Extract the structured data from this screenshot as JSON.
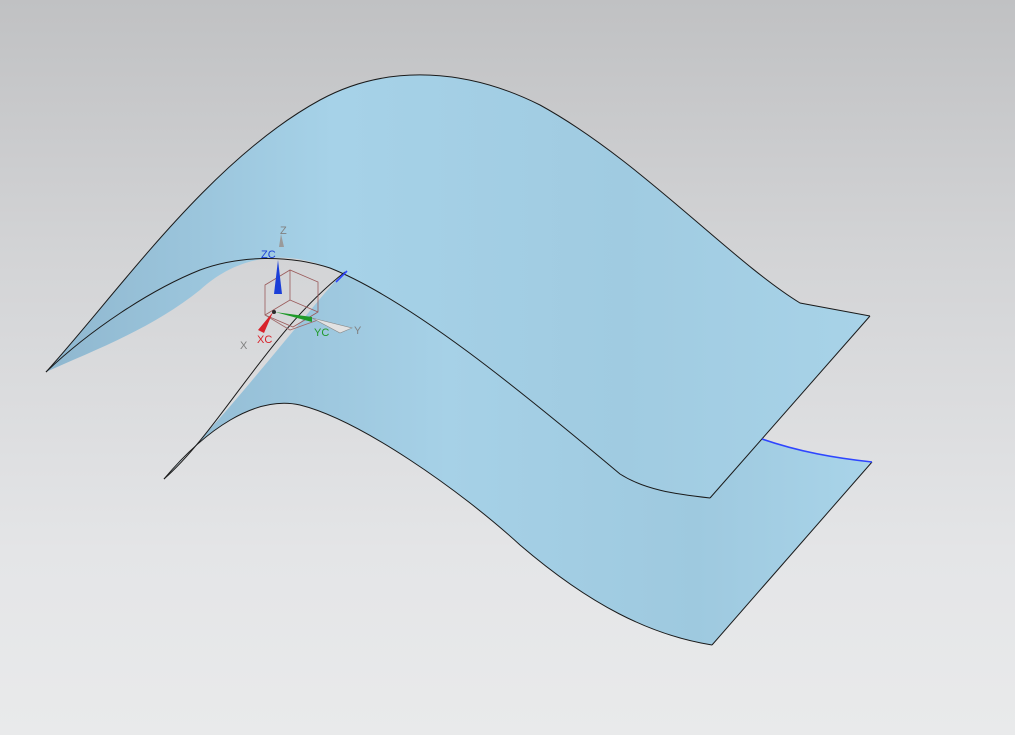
{
  "viewport": {
    "background_top": "#c0c1c3",
    "background_bottom": "#e9eaeb"
  },
  "surfaces": {
    "fill_color": "#a6d2e8",
    "shade_color": "#86b3cc",
    "edge_color": "#1a1a1a",
    "selected_curve_color": "#2f45ff"
  },
  "triad": {
    "zc_label": "ZC",
    "yc_label": "YC",
    "xc_label": "XC",
    "z_label": "Z",
    "y_label": "Y",
    "x_label": "X",
    "zc_color": "#1b3fd8",
    "yc_color": "#1f9a2a",
    "xc_color": "#d8222a"
  }
}
